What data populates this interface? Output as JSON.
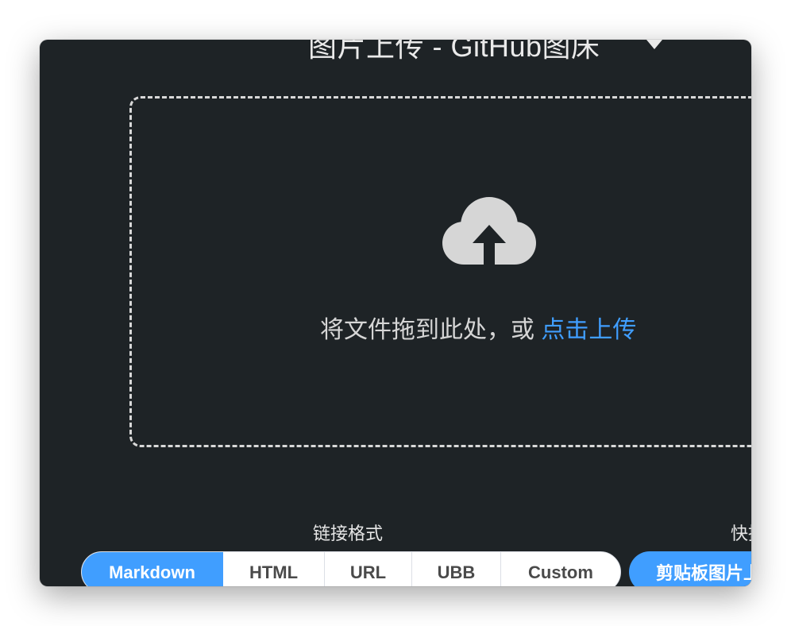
{
  "header": {
    "title": "图片上传 - GitHub图床"
  },
  "dropzone": {
    "text": "将文件拖到此处，或 ",
    "link": "点击上传",
    "icon": "cloud-upload-icon"
  },
  "link_format": {
    "label": "链接格式",
    "options": [
      "Markdown",
      "HTML",
      "URL",
      "UBB",
      "Custom"
    ],
    "selected": "Markdown"
  },
  "quick_upload": {
    "label": "快捷上传",
    "clipboard_button": "剪贴板图片上传"
  },
  "colors": {
    "background": "#1e2326",
    "accent": "#409eff",
    "text": "#d6d6d6"
  }
}
